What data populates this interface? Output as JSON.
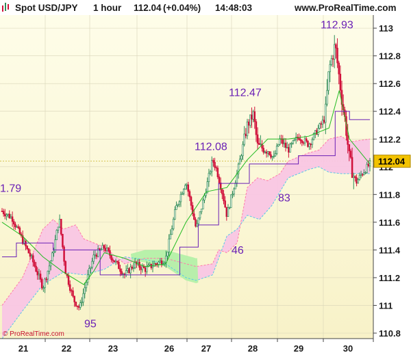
{
  "header": {
    "instrument": "Spot USD/JPY",
    "timeframe": "1 hour",
    "last_price": "112.04",
    "change": "(+0.04%)",
    "time": "14:48:03",
    "site": "www.ProRealTime.com"
  },
  "watermark": "© ProRealTime.com",
  "colors": {
    "up_candle": "#2e8b57",
    "down_candle": "#d0103a",
    "kumo_bull": "#b4f0a8",
    "kumo_bear": "#f9c6e4",
    "kumo_span_b_edge": "#58c8e8",
    "kumo_span_a_edge": "#ff7aa8",
    "tenkan": "#22bb22",
    "kijun": "#6a1fb5",
    "annotation": "#6a1fb5",
    "current_price_box": "#f2c200"
  },
  "chart_data": {
    "type": "candlestick",
    "title": "Spot USD/JPY",
    "indicators": [
      "Ichimoku cloud",
      "Tenkan-sen",
      "Kijun-sen"
    ],
    "ylim": [
      110.8,
      113.05
    ],
    "y_ticks": [
      "113",
      "112.8",
      "112.6",
      "112.4",
      "112.2",
      "112",
      "111.8",
      "111.6",
      "111.4",
      "111.2",
      "111",
      "110.8"
    ],
    "y_tick_values": [
      113,
      112.8,
      112.6,
      112.4,
      112.2,
      112,
      111.8,
      111.6,
      111.4,
      111.2,
      111,
      110.8
    ],
    "x_ticks": [
      "21",
      "22",
      "23",
      "26",
      "27",
      "28",
      "29",
      "30"
    ],
    "current_price": "112.04",
    "grid": true,
    "annotations": [
      {
        "text": "1.79",
        "value": 111.79
      },
      {
        "text": "95",
        "value": 110.95
      },
      {
        "text": "46",
        "value": 111.46
      },
      {
        "text": "112.08",
        "value": 112.08
      },
      {
        "text": "112.47",
        "value": 112.47
      },
      {
        "text": "83",
        "value": 111.83
      },
      {
        "text": "112.93",
        "value": 112.93
      }
    ],
    "path": [
      [
        0,
        111.68
      ],
      [
        0.5,
        111.63
      ],
      [
        1,
        111.47
      ],
      [
        1.5,
        111.32
      ],
      [
        2,
        111.13
      ],
      [
        2.5,
        111.38
      ],
      [
        2.8,
        111.63
      ],
      [
        3.1,
        111.25
      ],
      [
        3.5,
        111.04
      ],
      [
        3.8,
        110.98
      ],
      [
        4.1,
        111.16
      ],
      [
        4.5,
        111.36
      ],
      [
        5,
        111.42
      ],
      [
        5.5,
        111.32
      ],
      [
        6,
        111.22
      ],
      [
        6.5,
        111.3
      ],
      [
        7,
        111.26
      ],
      [
        7.5,
        111.3
      ],
      [
        8,
        111.33
      ],
      [
        8.5,
        111.7
      ],
      [
        9,
        111.9
      ],
      [
        9.5,
        111.55
      ],
      [
        10,
        111.85
      ],
      [
        10.3,
        112.05
      ],
      [
        10.5,
        111.98
      ],
      [
        10.8,
        111.8
      ],
      [
        11,
        111.65
      ],
      [
        11.5,
        111.95
      ],
      [
        12,
        112.3
      ],
      [
        12.3,
        112.38
      ],
      [
        12.5,
        112.15
      ],
      [
        13,
        112.12
      ],
      [
        13.3,
        112.06
      ],
      [
        13.6,
        112.2
      ],
      [
        14,
        112.12
      ],
      [
        14.5,
        112.22
      ],
      [
        15,
        112.16
      ],
      [
        15.5,
        112.28
      ],
      [
        15.8,
        112.35
      ],
      [
        16,
        112.7
      ],
      [
        16.3,
        112.88
      ],
      [
        16.6,
        112.52
      ],
      [
        16.8,
        112.32
      ],
      [
        17,
        112.05
      ],
      [
        17.3,
        111.88
      ],
      [
        17.6,
        111.95
      ],
      [
        18,
        112.02
      ]
    ],
    "tenkan": [
      [
        0,
        111.6
      ],
      [
        1,
        111.5
      ],
      [
        2,
        111.35
      ],
      [
        3,
        111.24
      ],
      [
        4,
        111.15
      ],
      [
        4.5,
        111.25
      ],
      [
        5,
        111.38
      ],
      [
        6,
        111.34
      ],
      [
        7,
        111.28
      ],
      [
        8,
        111.3
      ],
      [
        9,
        111.6
      ],
      [
        10,
        111.82
      ],
      [
        11,
        111.85
      ],
      [
        12,
        112.05
      ],
      [
        13,
        112.2
      ],
      [
        14,
        112.2
      ],
      [
        15,
        112.22
      ],
      [
        16,
        112.28
      ],
      [
        16.5,
        112.55
      ],
      [
        17,
        112.2
      ],
      [
        18,
        112.02
      ]
    ],
    "kijun": [
      [
        0,
        111.35
      ],
      [
        0.7,
        111.35
      ],
      [
        0.7,
        111.45
      ],
      [
        2.5,
        111.45
      ],
      [
        2.5,
        111.4
      ],
      [
        4.8,
        111.4
      ],
      [
        4.8,
        111.22
      ],
      [
        8.7,
        111.22
      ],
      [
        8.7,
        111.42
      ],
      [
        9.6,
        111.42
      ],
      [
        9.6,
        111.58
      ],
      [
        10.6,
        111.58
      ],
      [
        10.6,
        111.88
      ],
      [
        12.1,
        111.88
      ],
      [
        12.1,
        112.02
      ],
      [
        14.5,
        112.02
      ],
      [
        14.5,
        112.08
      ],
      [
        16.3,
        112.08
      ],
      [
        16.3,
        112.4
      ],
      [
        17,
        112.4
      ],
      [
        17,
        112.34
      ],
      [
        18,
        112.34
      ]
    ],
    "span_b": [
      [
        0,
        110.76
      ],
      [
        1,
        110.96
      ],
      [
        2,
        111.15
      ],
      [
        3,
        111.24
      ],
      [
        4,
        111.22
      ],
      [
        5,
        111.26
      ],
      [
        6,
        111.35
      ],
      [
        7,
        111.33
      ],
      [
        8,
        111.3
      ],
      [
        9,
        111.2
      ],
      [
        9.5,
        111.18
      ],
      [
        10.3,
        111.22
      ],
      [
        10.6,
        111.34
      ],
      [
        11,
        111.5
      ],
      [
        11.5,
        111.55
      ],
      [
        12,
        111.65
      ],
      [
        12.6,
        111.62
      ],
      [
        13.2,
        111.72
      ],
      [
        14,
        111.92
      ],
      [
        15,
        111.98
      ],
      [
        15.5,
        112.0
      ],
      [
        16,
        111.96
      ],
      [
        16.6,
        111.95
      ],
      [
        17,
        111.95
      ],
      [
        18,
        111.95
      ]
    ],
    "span_a": [
      [
        0,
        111.0
      ],
      [
        1,
        111.2
      ],
      [
        2,
        111.55
      ],
      [
        2.5,
        111.62
      ],
      [
        3,
        111.55
      ],
      [
        3.6,
        111.58
      ],
      [
        4,
        111.48
      ],
      [
        5,
        111.42
      ],
      [
        6,
        111.3
      ],
      [
        7,
        111.34
      ],
      [
        8,
        111.34
      ],
      [
        9,
        111.3
      ],
      [
        9.5,
        111.28
      ],
      [
        10.3,
        111.3
      ],
      [
        10.6,
        111.4
      ],
      [
        11,
        111.38
      ],
      [
        11.5,
        111.45
      ],
      [
        12,
        111.85
      ],
      [
        12.5,
        111.92
      ],
      [
        13,
        111.9
      ],
      [
        13.6,
        111.95
      ],
      [
        14,
        112.04
      ],
      [
        15,
        112.1
      ],
      [
        15.5,
        112.12
      ],
      [
        16,
        112.2
      ],
      [
        16.6,
        112.22
      ],
      [
        17,
        112.18
      ],
      [
        18,
        112.2
      ]
    ]
  }
}
